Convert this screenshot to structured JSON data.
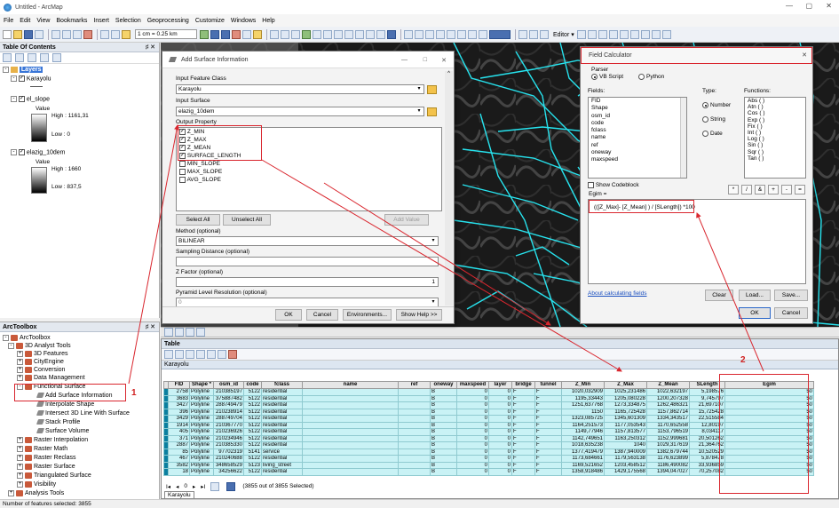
{
  "window": {
    "title": "Untitled - ArcMap",
    "controls": [
      "—",
      "▢",
      "✕"
    ]
  },
  "menu": [
    "File",
    "Edit",
    "View",
    "Bookmarks",
    "Insert",
    "Selection",
    "Geoprocessing",
    "Customize",
    "Windows",
    "Help"
  ],
  "toolbar": {
    "scale": "1 cm = 0.25 km",
    "editor_label": "Editor ▾"
  },
  "toc": {
    "title": "Table Of Contents",
    "pin": "♯ ✕",
    "root": "Layers",
    "layers": [
      {
        "name": "Karayolu"
      },
      {
        "name": "el_slope",
        "value_label": "Value",
        "high": "High : 1161,31",
        "low": "Low : 0"
      },
      {
        "name": "elazig_10dem",
        "value_label": "Value",
        "high": "High : 1660",
        "low": "Low : 837,5"
      }
    ]
  },
  "arctoolbox": {
    "title": "ArcToolbox",
    "pin": "♯ ✕",
    "items": [
      "ArcToolbox",
      "3D Analyst Tools",
      "3D Features",
      "CityEngine",
      "Conversion",
      "Data Management",
      "Functional Surface",
      "Add Surface Information",
      "Interpolate Shape",
      "Intersect 3D Line With Surface",
      "Stack Profile",
      "Surface Volume",
      "Raster Interpolation",
      "Raster Math",
      "Raster Reclass",
      "Raster Surface",
      "Triangulated Surface",
      "Visibility",
      "Analysis Tools"
    ]
  },
  "annotations": {
    "one": "1",
    "two": "2"
  },
  "add_surface": {
    "title": "Add Surface Information",
    "controls": [
      "—",
      "□",
      "✕"
    ],
    "input_feature_label": "Input Feature Class",
    "input_feature_value": "Karayolu",
    "input_surface_label": "Input Surface",
    "input_surface_value": "elazig_10dem",
    "output_property_label": "Output Property",
    "properties": [
      {
        "name": "Z_MIN",
        "checked": true
      },
      {
        "name": "Z_MAX",
        "checked": true
      },
      {
        "name": "Z_MEAN",
        "checked": true
      },
      {
        "name": "SURFACE_LENGTH",
        "checked": true
      },
      {
        "name": "MIN_SLOPE",
        "checked": false
      },
      {
        "name": "MAX_SLOPE",
        "checked": false
      },
      {
        "name": "AVG_SLOPE",
        "checked": false
      }
    ],
    "select_all": "Select All",
    "unselect_all": "Unselect All",
    "add_value": "Add Value",
    "method_label": "Method (optional)",
    "method_value": "BILINEAR",
    "sampling_label": "Sampling Distance (optional)",
    "zfactor_label": "Z Factor (optional)",
    "zfactor_value": "1",
    "pyramid_label": "Pyramid Level Resolution (optional)",
    "pyramid_value": "0",
    "ok": "OK",
    "cancel": "Cancel",
    "environments": "Environments...",
    "show_help": "Show Help >>"
  },
  "field_calc": {
    "title": "Field Calculator",
    "close": "✕",
    "parser_label": "Parser",
    "vb": "VB Script",
    "python": "Python",
    "fields_label": "Fields:",
    "fields": [
      "FID",
      "Shape",
      "osm_id",
      "code",
      "fclass",
      "name",
      "ref",
      "oneway",
      "maxspeed"
    ],
    "type_label": "Type:",
    "types": [
      "Number",
      "String",
      "Date"
    ],
    "functions_label": "Functions:",
    "functions": [
      "Abs ( )",
      "Atn ( )",
      "Cos ( )",
      "Exp ( )",
      "Fix ( )",
      "Int ( )",
      "Log ( )",
      "Sin ( )",
      "Sqr ( )",
      "Tan ( )"
    ],
    "show_codeblock": "Show Codeblock",
    "ops": [
      "*",
      "/",
      "&",
      "+",
      "-",
      "="
    ],
    "target": "Egim =",
    "expression": "(([Z_Max]- [Z_Mean] ) / [SLength]) *100",
    "about": "About calculating fields",
    "clear": "Clear",
    "load": "Load...",
    "save": "Save...",
    "ok": "OK",
    "cancel": "Cancel"
  },
  "table": {
    "title": "Table",
    "layer": "Karayolu",
    "columns": [
      "FID",
      "Shape *",
      "osm_id",
      "code",
      "fclass",
      "name",
      "ref",
      "oneway",
      "maxspeed",
      "layer",
      "bridge",
      "tunnel",
      "Z_Min",
      "Z_Max",
      "Z_Mean",
      "SLength",
      "Egim"
    ],
    "rows": [
      [
        "2758",
        "Polyline",
        "210385197",
        "5122",
        "residential",
        "",
        "",
        "B",
        "0",
        "0",
        "F",
        "F",
        "1020,032909",
        "1025,231486",
        "1022,632197",
        "5,198576",
        "50"
      ],
      [
        "3683",
        "Polyline",
        "375887482",
        "5122",
        "residential",
        "",
        "",
        "B",
        "0",
        "0",
        "F",
        "F",
        "1195,33443",
        "1205,080228",
        "1200,207328",
        "9,745797",
        "50"
      ],
      [
        "3427",
        "Polyline",
        "288749479",
        "5122",
        "residential",
        "",
        "",
        "B",
        "0",
        "0",
        "F",
        "F",
        "1251,637768",
        "1273,334875",
        "1262,486321",
        "21,697107",
        "50"
      ],
      [
        "396",
        "Polyline",
        "210238914",
        "5122",
        "residential",
        "",
        "",
        "B",
        "0",
        "0",
        "F",
        "F",
        "1150",
        "1165,725428",
        "1157,862714",
        "15,725428",
        "50"
      ],
      [
        "3429",
        "Polyline",
        "288749704",
        "5122",
        "residential",
        "",
        "",
        "B",
        "0",
        "0",
        "F",
        "F",
        "1323,085725",
        "1345,601309",
        "1334,343517",
        "22,515584",
        "50"
      ],
      [
        "1914",
        "Polyline",
        "210367770",
        "5122",
        "residential",
        "",
        "",
        "B",
        "0",
        "0",
        "F",
        "F",
        "1164,251573",
        "1177,053543",
        "1170,652558",
        "12,80197",
        "50"
      ],
      [
        "405",
        "Polyline",
        "210236926",
        "5122",
        "residential",
        "",
        "",
        "B",
        "0",
        "0",
        "F",
        "F",
        "1149,77946",
        "1157,813577",
        "1153,796519",
        "8,034117",
        "50"
      ],
      [
        "371",
        "Polyline",
        "210234946",
        "5122",
        "residential",
        "",
        "",
        "B",
        "0",
        "0",
        "F",
        "F",
        "1142,749651",
        "1163,250312",
        "1152,999681",
        "20,501262",
        "50"
      ],
      [
        "2887",
        "Polyline",
        "210385330",
        "5122",
        "residential",
        "",
        "",
        "B",
        "0",
        "0",
        "F",
        "F",
        "1018,635238",
        "1040",
        "1029,317619",
        "21,364762",
        "50"
      ],
      [
        "85",
        "Polyline",
        "97702319",
        "5141",
        "service",
        "",
        "",
        "B",
        "0",
        "0",
        "F",
        "F",
        "1377,419479",
        "1387,940009",
        "1382,679744",
        "10,520529",
        "50"
      ],
      [
        "467",
        "Polyline",
        "210240688",
        "5122",
        "residential",
        "",
        "",
        "B",
        "0",
        "0",
        "F",
        "F",
        "1173,684661",
        "1179,563138",
        "1176,623899",
        "5,878478",
        "50"
      ],
      [
        "3582",
        "Polyline",
        "348658529",
        "5123",
        "living_street",
        "",
        "",
        "B",
        "0",
        "0",
        "F",
        "F",
        "1169,521652",
        "1203,458512",
        "1186,490082",
        "33,936859",
        "50"
      ],
      [
        "18",
        "Polyline",
        "34256622",
        "5122",
        "residential",
        "",
        "",
        "B",
        "0",
        "0",
        "F",
        "F",
        "1358,918486",
        "1429,175568",
        "1394,047027",
        "70,257082",
        "50"
      ]
    ],
    "nav_text": "(3855 out of 3855 Selected)",
    "tab": "Karayolu"
  },
  "status": "Number of features selected: 3855"
}
